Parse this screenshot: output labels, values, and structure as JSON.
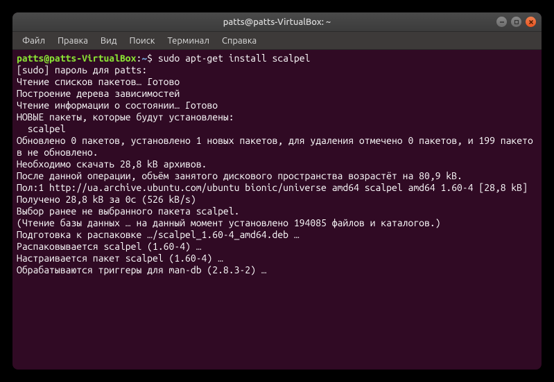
{
  "titlebar": {
    "title": "patts@patts-VirtualBox: ~"
  },
  "menubar": {
    "items": [
      "Файл",
      "Правка",
      "Вид",
      "Поиск",
      "Терминал",
      "Справка"
    ]
  },
  "prompt": {
    "user_host": "patts@patts-VirtualBox",
    "separator": ":",
    "path": "~",
    "sigil": "$"
  },
  "command": "sudo apt-get install scalpel",
  "output_lines": [
    "[sudo] пароль для patts:",
    "Чтение списков пакетов… Готово",
    "Построение дерева зависимостей",
    "Чтение информации о состоянии… Готово",
    "НОВЫЕ пакеты, которые будут установлены:",
    "  scalpel",
    "Обновлено 0 пакетов, установлено 1 новых пакетов, для удаления отмечено 0 пакетов, и 199 пакетов не обновлено.",
    "Необходимо скачать 28,8 kB архивов.",
    "После данной операции, объём занятого дискового пространства возрастёт на 80,9 kB.",
    "Пол:1 http://ua.archive.ubuntu.com/ubuntu bionic/universe amd64 scalpel amd64 1.60-4 [28,8 kB]",
    "Получено 28,8 kB за 0с (526 kB/s)",
    "Выбор ранее не выбранного пакета scalpel.",
    "(Чтение базы данных … на данный момент установлено 194085 файлов и каталогов.)",
    "Подготовка к распаковке …/scalpel_1.60-4_amd64.deb …",
    "Распаковывается scalpel (1.60-4) …",
    "Настраивается пакет scalpel (1.60-4) …",
    "Обрабатываются триггеры для man-db (2.8.3-2) …"
  ]
}
